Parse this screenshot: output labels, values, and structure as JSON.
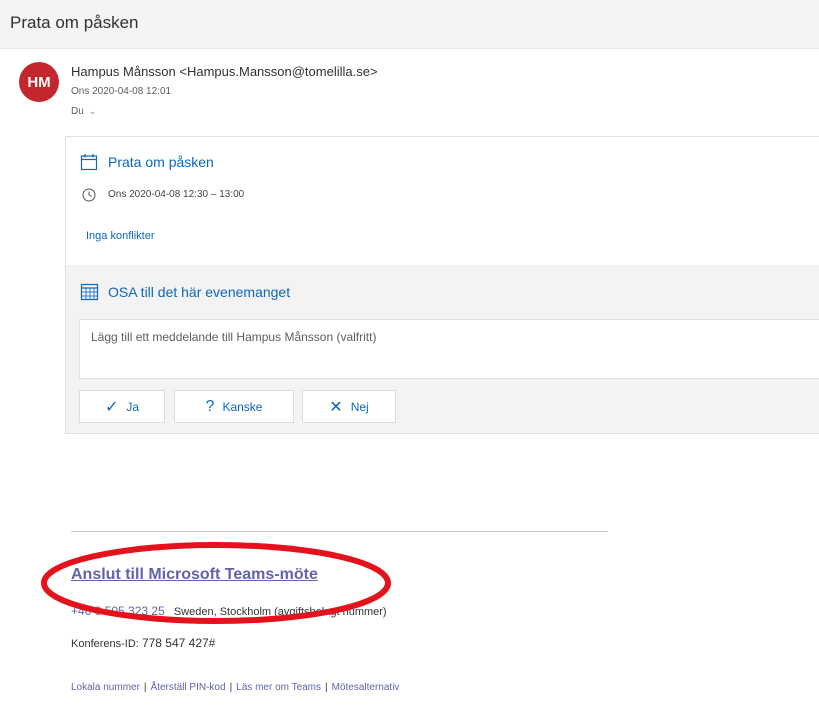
{
  "subject": "Prata om påsken",
  "sender": {
    "initials": "HM",
    "display": "Hampus Månsson <Hampus.Mansson@tomelilla.se>",
    "date": "Ons 2020-04-08 12:01",
    "to": "Du"
  },
  "event": {
    "title": "Prata om påsken",
    "time": "Ons 2020-04-08 12:30 – 13:00",
    "conflicts": "Inga konflikter"
  },
  "rsvp": {
    "title": "OSA till det här evenemanget",
    "message_placeholder": "Lägg till ett meddelande till Hampus Månsson (valfritt)",
    "yes_label": "Ja",
    "maybe_label": "Kanske",
    "no_label": "Nej"
  },
  "teams": {
    "join_label": "Anslut till Microsoft Teams-möte",
    "phone": "+46 8 505 323 25",
    "phone_desc": "Sweden, Stockholm (avgiftsbelagt nummer)",
    "conference_label": "Konferens-ID:",
    "conference_id": "778 547 427#",
    "links": [
      "Lokala nummer",
      "Återställ PIN-kod",
      "Läs mer om Teams",
      "Mötesalternativ"
    ]
  },
  "colors": {
    "accent": "#0d67b8",
    "teams": "#6264a7",
    "avatar": "#c4262e",
    "annotation": "#e4121c"
  },
  "icons": {
    "event": "calendar-icon",
    "time": "clock-icon",
    "rsvp": "calendar-grid-icon",
    "yes": "checkmark-icon",
    "maybe": "question-icon",
    "no": "close-icon",
    "expand": "chevron-down-icon"
  }
}
